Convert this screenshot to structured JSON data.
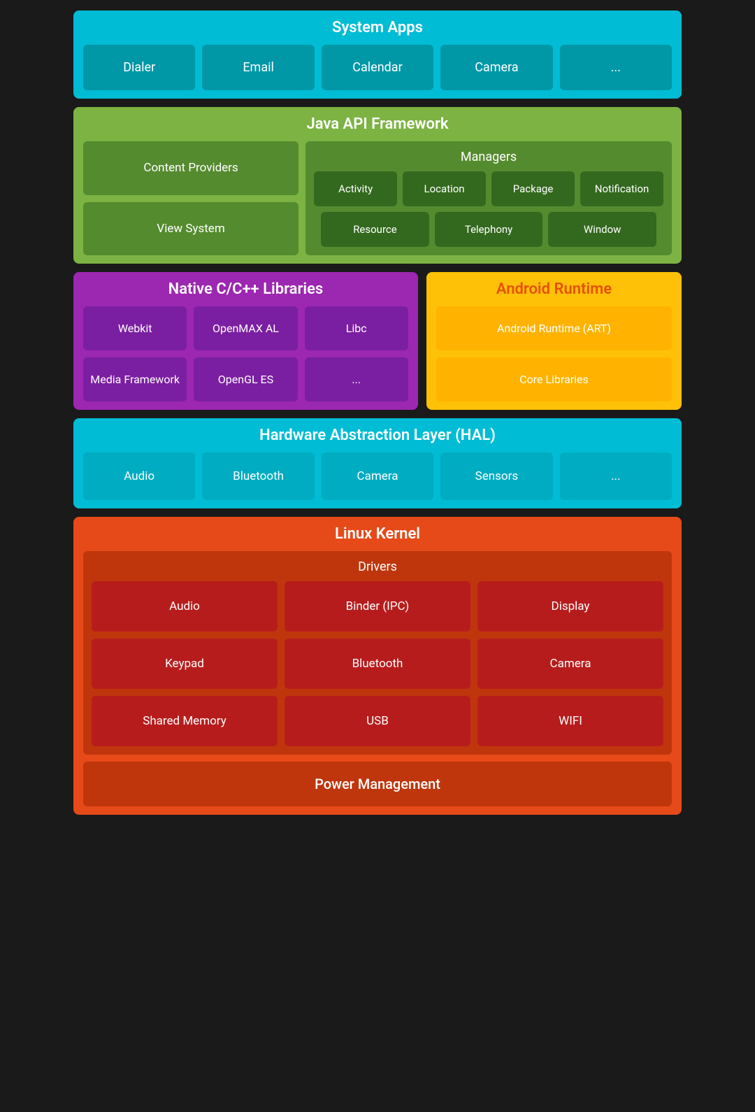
{
  "systemApps": {
    "title": "System Apps",
    "apps": [
      "Dialer",
      "Email",
      "Calendar",
      "Camera",
      "..."
    ]
  },
  "javaApi": {
    "title": "Java API Framework",
    "leftItems": [
      "Content Providers",
      "View System"
    ],
    "managers": {
      "title": "Managers",
      "row1": [
        "Activity",
        "Location",
        "Package",
        "Notification"
      ],
      "row2": [
        "Resource",
        "Telephony",
        "Window"
      ]
    }
  },
  "nativeCpp": {
    "title": "Native C/C++ Libraries",
    "row1": [
      "Webkit",
      "OpenMAX AL",
      "Libc"
    ],
    "row2": [
      "Media Framework",
      "OpenGL ES",
      "..."
    ]
  },
  "androidRuntime": {
    "title": "Android Runtime",
    "items": [
      "Android Runtime (ART)",
      "Core Libraries"
    ]
  },
  "hal": {
    "title": "Hardware Abstraction Layer (HAL)",
    "items": [
      "Audio",
      "Bluetooth",
      "Camera",
      "Sensors",
      "..."
    ]
  },
  "linuxKernel": {
    "title": "Linux Kernel",
    "drivers": {
      "title": "Drivers",
      "row1": [
        "Audio",
        "Binder (IPC)",
        "Display"
      ],
      "row2": [
        "Keypad",
        "Bluetooth",
        "Camera"
      ],
      "row3": [
        "Shared Memory",
        "USB",
        "WIFI"
      ]
    },
    "powerManagement": "Power Management"
  }
}
